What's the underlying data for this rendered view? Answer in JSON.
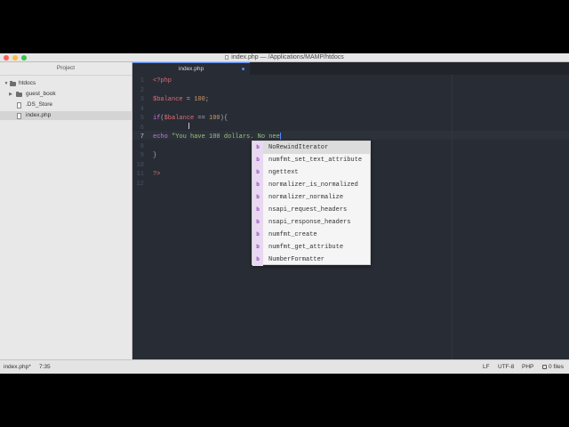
{
  "window": {
    "title": "index.php — /Applications/MAMP/htdocs"
  },
  "sidebar": {
    "header": "Project",
    "root": "htdocs",
    "items": [
      {
        "label": "guest_book",
        "type": "folder"
      },
      {
        "label": ".DS_Store",
        "type": "file"
      },
      {
        "label": "index.php",
        "type": "file",
        "selected": true
      }
    ]
  },
  "tabs": [
    {
      "label": "index.php",
      "modified": true
    }
  ],
  "editor": {
    "line_numbers": [
      "1",
      "2",
      "3",
      "4",
      "5",
      "6",
      "7",
      "8",
      "9",
      "10",
      "11",
      "12"
    ],
    "lines": [
      {
        "n": "1",
        "parts": [
          [
            "tag",
            "<?php"
          ]
        ]
      },
      {
        "n": "2",
        "parts": []
      },
      {
        "n": "3",
        "parts": [
          [
            "var",
            "$balance"
          ],
          [
            "plain",
            " = "
          ],
          [
            "num",
            "100"
          ],
          [
            "plain",
            ";"
          ]
        ]
      },
      {
        "n": "4",
        "parts": []
      },
      {
        "n": "5",
        "parts": [
          [
            "kw",
            "if"
          ],
          [
            "plain",
            "("
          ],
          [
            "var",
            "$balance"
          ],
          [
            "plain",
            " == "
          ],
          [
            "num",
            "100"
          ],
          [
            "plain",
            "){"
          ]
        ]
      },
      {
        "n": "6",
        "parts": []
      },
      {
        "n": "7",
        "parts": [
          [
            "kw",
            "echo"
          ],
          [
            "plain",
            " "
          ],
          [
            "str",
            "\"You have 100 dollars. No nee"
          ]
        ]
      },
      {
        "n": "8",
        "parts": []
      },
      {
        "n": "9",
        "parts": [
          [
            "plain",
            "}"
          ]
        ]
      },
      {
        "n": "10",
        "parts": []
      },
      {
        "n": "11",
        "parts": [
          [
            "tag",
            "?>"
          ]
        ]
      },
      {
        "n": "12",
        "parts": []
      }
    ],
    "current_line": "7"
  },
  "autocomplete": {
    "icon_letter": "b",
    "items": [
      "NoRewindIterator",
      "numfmt_set_text_attribute",
      "ngettext",
      "normalizer_is_normalized",
      "normalizer_normalize",
      "nsapi_request_headers",
      "nsapi_response_headers",
      "numfmt_create",
      "numfmt_get_attribute",
      "NumberFormatter"
    ]
  },
  "statusbar": {
    "file": "index.php*",
    "cursor": "7:35",
    "line_ending": "LF",
    "encoding": "UTF-8",
    "grammar": "PHP",
    "files": "0 files"
  },
  "colors": {
    "editor_bg": "#282c34",
    "accent": "#528bff",
    "keyword": "#c678dd",
    "variable": "#e06c75",
    "number": "#d19a66",
    "string": "#98c379"
  }
}
